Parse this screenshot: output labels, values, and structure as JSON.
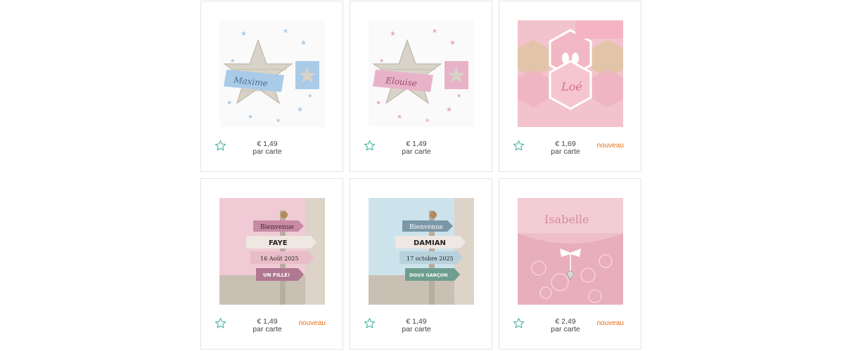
{
  "accent_color": "#4db6a3",
  "badge_color": "#e8701a",
  "products": [
    {
      "image": "star card blue with name Maxime",
      "image_text": "Maxime",
      "favorite_icon": "star-outline-icon",
      "price": "€ 1,49",
      "unit": "par carte",
      "badge": ""
    },
    {
      "image": "star card pink with name Elouise",
      "image_text": "Elouise",
      "favorite_icon": "star-outline-icon",
      "price": "€ 1,49",
      "unit": "par carte",
      "badge": ""
    },
    {
      "image": "pink hexagon card with baby feet and name Loé",
      "image_text": "Loé",
      "favorite_icon": "star-outline-icon",
      "price": "€ 1,69",
      "unit": "par carte",
      "badge": "nouveau"
    },
    {
      "image": "pink signpost card",
      "signs": [
        "Bienvenue",
        "FAYE",
        "16 Août 2025",
        "UN FILLE!"
      ],
      "favorite_icon": "star-outline-icon",
      "price": "€ 1,49",
      "unit": "par carte",
      "badge": "nouveau"
    },
    {
      "image": "blue signpost card",
      "signs": [
        "Bienvenue",
        "DAMIAN",
        "17 octobre 2025",
        "DOUX GARÇON"
      ],
      "favorite_icon": "star-outline-icon",
      "price": "€ 1,49",
      "unit": "par carte",
      "badge": ""
    },
    {
      "image": "pink lace card with ribbon and name Isabelle",
      "image_text": "Isabelle",
      "favorite_icon": "star-outline-icon",
      "price": "€ 2,49",
      "unit": "par carte",
      "badge": "nouveau"
    }
  ]
}
